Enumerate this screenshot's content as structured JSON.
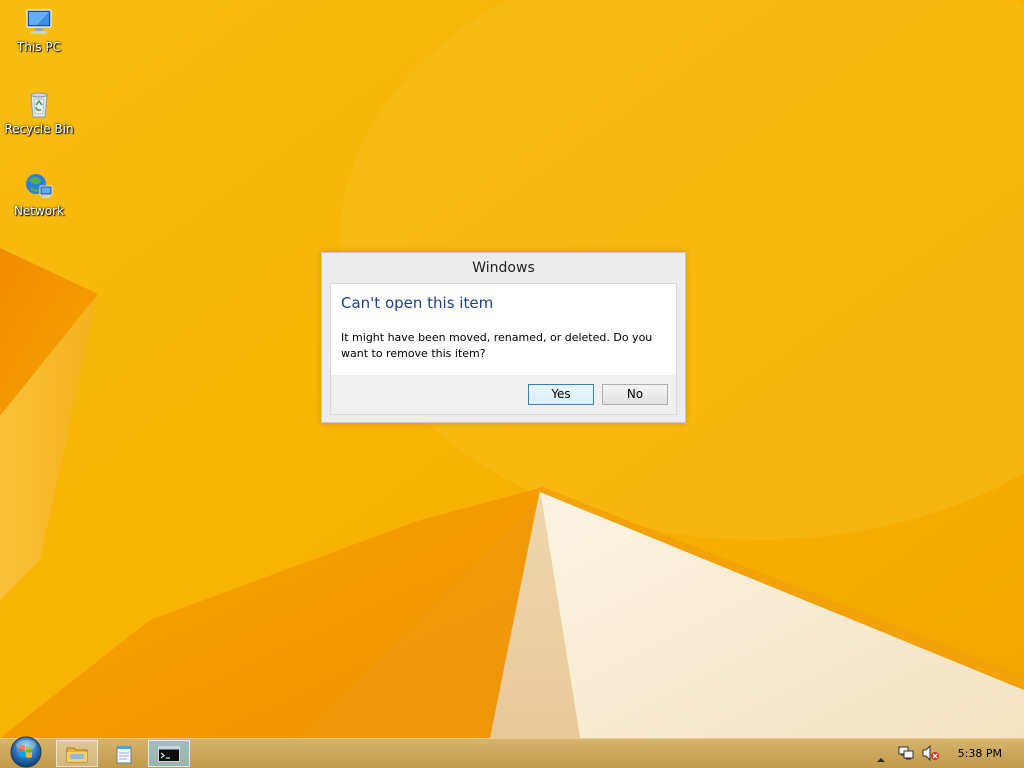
{
  "desktop": {
    "icons": [
      {
        "label": "This PC",
        "icon": "computer-icon"
      },
      {
        "label": "Recycle Bin",
        "icon": "recycle-bin-icon"
      },
      {
        "label": "Network",
        "icon": "network-icon"
      }
    ]
  },
  "dialog": {
    "title": "Windows",
    "heading": "Can't open this item",
    "message": "It might have been moved, renamed, or deleted. Do you want to remove this item?",
    "buttons": {
      "yes": "Yes",
      "no": "No"
    },
    "default_button": "yes"
  },
  "taskbar": {
    "pinned": [
      {
        "icon": "start-orb-icon"
      },
      {
        "icon": "file-explorer-icon",
        "state": "open"
      },
      {
        "icon": "notepad-icon"
      },
      {
        "icon": "command-prompt-icon",
        "state": "active"
      }
    ],
    "tray": {
      "icons": [
        "show-hidden-icons-chevron",
        "network-tray-icon",
        "volume-muted-icon"
      ],
      "clock": "5:38 PM"
    }
  },
  "colors": {
    "wallpaper": "#f6b400",
    "dialog_heading": "#1e3f8a",
    "taskbar": "#c9a55a"
  }
}
